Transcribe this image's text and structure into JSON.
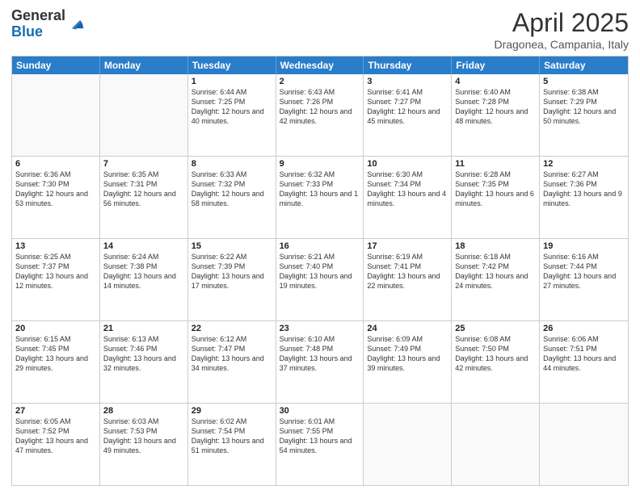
{
  "header": {
    "logo_general": "General",
    "logo_blue": "Blue",
    "month_title": "April 2025",
    "location": "Dragonea, Campania, Italy"
  },
  "weekdays": [
    "Sunday",
    "Monday",
    "Tuesday",
    "Wednesday",
    "Thursday",
    "Friday",
    "Saturday"
  ],
  "rows": [
    [
      {
        "day": "",
        "sunrise": "",
        "sunset": "",
        "daylight": ""
      },
      {
        "day": "",
        "sunrise": "",
        "sunset": "",
        "daylight": ""
      },
      {
        "day": "1",
        "sunrise": "Sunrise: 6:44 AM",
        "sunset": "Sunset: 7:25 PM",
        "daylight": "Daylight: 12 hours and 40 minutes."
      },
      {
        "day": "2",
        "sunrise": "Sunrise: 6:43 AM",
        "sunset": "Sunset: 7:26 PM",
        "daylight": "Daylight: 12 hours and 42 minutes."
      },
      {
        "day": "3",
        "sunrise": "Sunrise: 6:41 AM",
        "sunset": "Sunset: 7:27 PM",
        "daylight": "Daylight: 12 hours and 45 minutes."
      },
      {
        "day": "4",
        "sunrise": "Sunrise: 6:40 AM",
        "sunset": "Sunset: 7:28 PM",
        "daylight": "Daylight: 12 hours and 48 minutes."
      },
      {
        "day": "5",
        "sunrise": "Sunrise: 6:38 AM",
        "sunset": "Sunset: 7:29 PM",
        "daylight": "Daylight: 12 hours and 50 minutes."
      }
    ],
    [
      {
        "day": "6",
        "sunrise": "Sunrise: 6:36 AM",
        "sunset": "Sunset: 7:30 PM",
        "daylight": "Daylight: 12 hours and 53 minutes."
      },
      {
        "day": "7",
        "sunrise": "Sunrise: 6:35 AM",
        "sunset": "Sunset: 7:31 PM",
        "daylight": "Daylight: 12 hours and 56 minutes."
      },
      {
        "day": "8",
        "sunrise": "Sunrise: 6:33 AM",
        "sunset": "Sunset: 7:32 PM",
        "daylight": "Daylight: 12 hours and 58 minutes."
      },
      {
        "day": "9",
        "sunrise": "Sunrise: 6:32 AM",
        "sunset": "Sunset: 7:33 PM",
        "daylight": "Daylight: 13 hours and 1 minute."
      },
      {
        "day": "10",
        "sunrise": "Sunrise: 6:30 AM",
        "sunset": "Sunset: 7:34 PM",
        "daylight": "Daylight: 13 hours and 4 minutes."
      },
      {
        "day": "11",
        "sunrise": "Sunrise: 6:28 AM",
        "sunset": "Sunset: 7:35 PM",
        "daylight": "Daylight: 13 hours and 6 minutes."
      },
      {
        "day": "12",
        "sunrise": "Sunrise: 6:27 AM",
        "sunset": "Sunset: 7:36 PM",
        "daylight": "Daylight: 13 hours and 9 minutes."
      }
    ],
    [
      {
        "day": "13",
        "sunrise": "Sunrise: 6:25 AM",
        "sunset": "Sunset: 7:37 PM",
        "daylight": "Daylight: 13 hours and 12 minutes."
      },
      {
        "day": "14",
        "sunrise": "Sunrise: 6:24 AM",
        "sunset": "Sunset: 7:38 PM",
        "daylight": "Daylight: 13 hours and 14 minutes."
      },
      {
        "day": "15",
        "sunrise": "Sunrise: 6:22 AM",
        "sunset": "Sunset: 7:39 PM",
        "daylight": "Daylight: 13 hours and 17 minutes."
      },
      {
        "day": "16",
        "sunrise": "Sunrise: 6:21 AM",
        "sunset": "Sunset: 7:40 PM",
        "daylight": "Daylight: 13 hours and 19 minutes."
      },
      {
        "day": "17",
        "sunrise": "Sunrise: 6:19 AM",
        "sunset": "Sunset: 7:41 PM",
        "daylight": "Daylight: 13 hours and 22 minutes."
      },
      {
        "day": "18",
        "sunrise": "Sunrise: 6:18 AM",
        "sunset": "Sunset: 7:42 PM",
        "daylight": "Daylight: 13 hours and 24 minutes."
      },
      {
        "day": "19",
        "sunrise": "Sunrise: 6:16 AM",
        "sunset": "Sunset: 7:44 PM",
        "daylight": "Daylight: 13 hours and 27 minutes."
      }
    ],
    [
      {
        "day": "20",
        "sunrise": "Sunrise: 6:15 AM",
        "sunset": "Sunset: 7:45 PM",
        "daylight": "Daylight: 13 hours and 29 minutes."
      },
      {
        "day": "21",
        "sunrise": "Sunrise: 6:13 AM",
        "sunset": "Sunset: 7:46 PM",
        "daylight": "Daylight: 13 hours and 32 minutes."
      },
      {
        "day": "22",
        "sunrise": "Sunrise: 6:12 AM",
        "sunset": "Sunset: 7:47 PM",
        "daylight": "Daylight: 13 hours and 34 minutes."
      },
      {
        "day": "23",
        "sunrise": "Sunrise: 6:10 AM",
        "sunset": "Sunset: 7:48 PM",
        "daylight": "Daylight: 13 hours and 37 minutes."
      },
      {
        "day": "24",
        "sunrise": "Sunrise: 6:09 AM",
        "sunset": "Sunset: 7:49 PM",
        "daylight": "Daylight: 13 hours and 39 minutes."
      },
      {
        "day": "25",
        "sunrise": "Sunrise: 6:08 AM",
        "sunset": "Sunset: 7:50 PM",
        "daylight": "Daylight: 13 hours and 42 minutes."
      },
      {
        "day": "26",
        "sunrise": "Sunrise: 6:06 AM",
        "sunset": "Sunset: 7:51 PM",
        "daylight": "Daylight: 13 hours and 44 minutes."
      }
    ],
    [
      {
        "day": "27",
        "sunrise": "Sunrise: 6:05 AM",
        "sunset": "Sunset: 7:52 PM",
        "daylight": "Daylight: 13 hours and 47 minutes."
      },
      {
        "day": "28",
        "sunrise": "Sunrise: 6:03 AM",
        "sunset": "Sunset: 7:53 PM",
        "daylight": "Daylight: 13 hours and 49 minutes."
      },
      {
        "day": "29",
        "sunrise": "Sunrise: 6:02 AM",
        "sunset": "Sunset: 7:54 PM",
        "daylight": "Daylight: 13 hours and 51 minutes."
      },
      {
        "day": "30",
        "sunrise": "Sunrise: 6:01 AM",
        "sunset": "Sunset: 7:55 PM",
        "daylight": "Daylight: 13 hours and 54 minutes."
      },
      {
        "day": "",
        "sunrise": "",
        "sunset": "",
        "daylight": ""
      },
      {
        "day": "",
        "sunrise": "",
        "sunset": "",
        "daylight": ""
      },
      {
        "day": "",
        "sunrise": "",
        "sunset": "",
        "daylight": ""
      }
    ]
  ]
}
